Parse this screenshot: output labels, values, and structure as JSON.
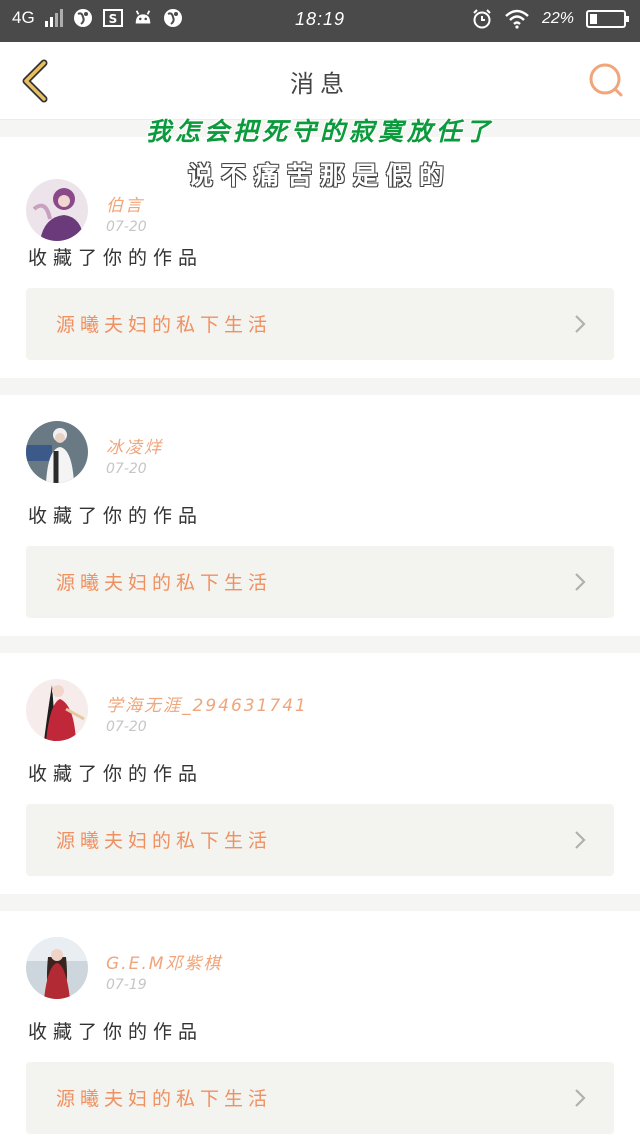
{
  "status_bar": {
    "network": "4G",
    "time": "18:19",
    "battery_text": "22%",
    "battery_level": 0.22
  },
  "nav": {
    "title": "消息",
    "back_icon": "chevron-left-icon",
    "search_icon": "search-icon"
  },
  "overlay": {
    "line1": "我怎会把死守的寂寞放任了",
    "line2": "说不痛苦那是假的"
  },
  "messages": [
    {
      "name": "伯言",
      "date": "07-20",
      "action": "收藏了你的作品",
      "work": "源曦夫妇的私下生活"
    },
    {
      "name": "冰凌烊",
      "date": "07-20",
      "action": "收藏了你的作品",
      "work": "源曦夫妇的私下生活"
    },
    {
      "name": "学海无涯_294631741",
      "date": "07-20",
      "action": "收藏了你的作品",
      "work": "源曦夫妇的私下生活"
    },
    {
      "name": "G.E.M邓紫棋",
      "date": "07-19",
      "action": "收藏了你的作品",
      "work": "源曦夫妇的私下生活"
    }
  ],
  "colors": {
    "accent": "#f0a57a",
    "work_text": "#f09060",
    "back_icon": "#e8c060",
    "lyric_green": "#0b9a3c"
  }
}
